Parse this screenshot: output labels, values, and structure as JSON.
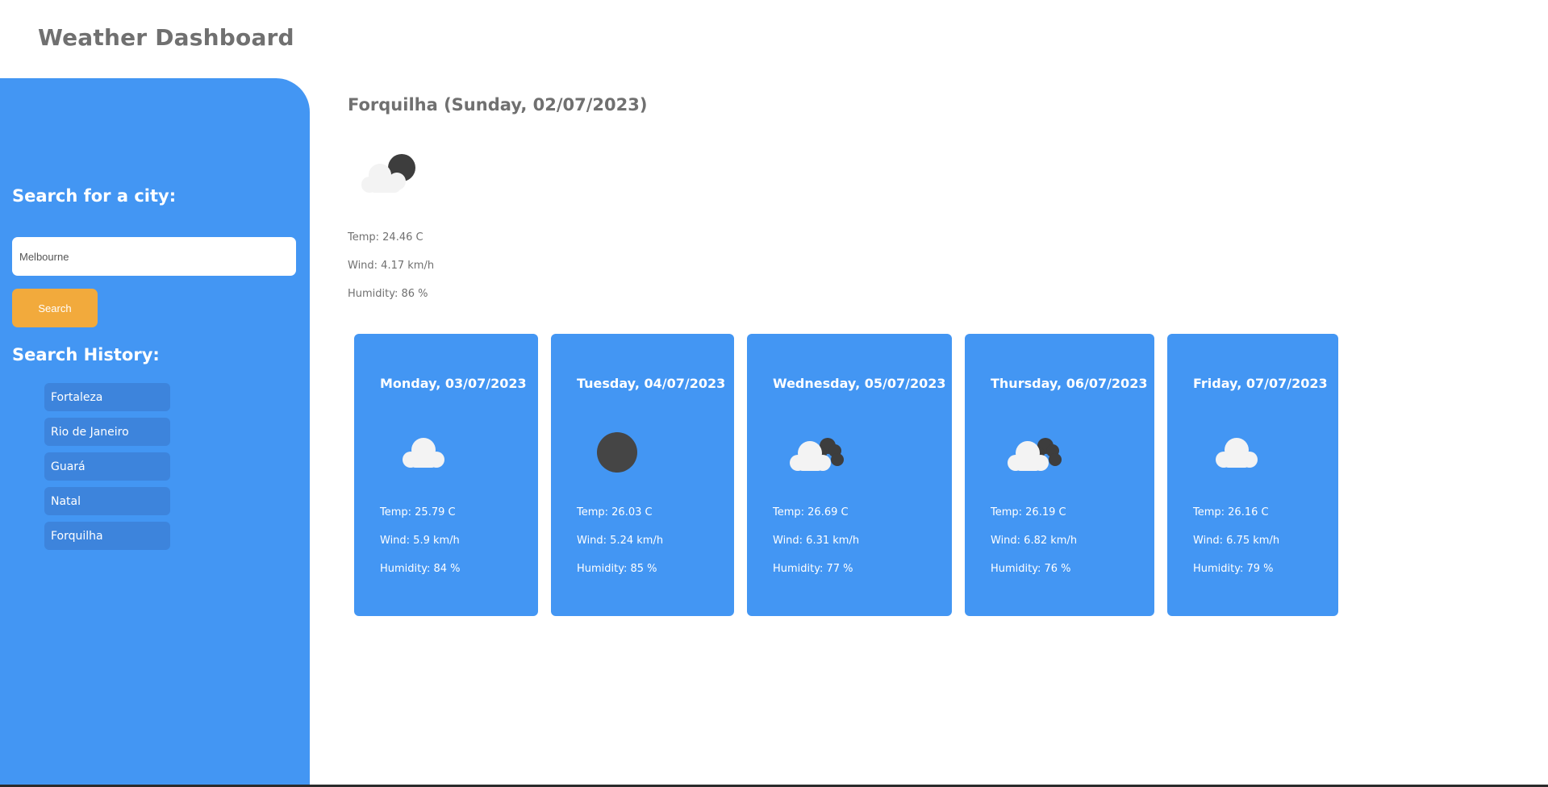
{
  "header": {
    "title": "Weather Dashboard"
  },
  "sidebar": {
    "search_heading": "Search for a city:",
    "search_value": "Melbourne",
    "search_button": "Search",
    "history_heading": "Search History:",
    "history": [
      "Fortaleza",
      "Rio de Janeiro",
      "Guará",
      "Natal",
      "Forquilha"
    ]
  },
  "colors": {
    "accent": "#4396f3",
    "button": "#f2aa3c",
    "history_item": "#3d84dc",
    "text_muted": "#707070"
  },
  "current": {
    "title": "Forquilha (Sunday, 02/07/2023)",
    "icon": "cloud-moon-icon",
    "temp": "Temp: 24.46 C",
    "wind": "Wind: 4.17 km/h",
    "humidity": "Humidity: 86 %"
  },
  "forecast": [
    {
      "date": "Monday, 03/07/2023",
      "icon": "cloud-icon",
      "temp": "Temp: 25.79 C",
      "wind": "Wind: 5.9 km/h",
      "humidity": "Humidity: 84 %"
    },
    {
      "date": "Tuesday, 04/07/2023",
      "icon": "moon-icon",
      "temp": "Temp: 26.03 C",
      "wind": "Wind: 5.24 km/h",
      "humidity": "Humidity: 85 %"
    },
    {
      "date": "Wednesday, 05/07/2023",
      "icon": "broken-clouds-icon",
      "temp": "Temp: 26.69 C",
      "wind": "Wind: 6.31 km/h",
      "humidity": "Humidity: 77 %"
    },
    {
      "date": "Thursday, 06/07/2023",
      "icon": "broken-clouds-icon",
      "temp": "Temp: 26.19 C",
      "wind": "Wind: 6.82 km/h",
      "humidity": "Humidity: 76 %"
    },
    {
      "date": "Friday, 07/07/2023",
      "icon": "cloud-icon",
      "temp": "Temp: 26.16 C",
      "wind": "Wind: 6.75 km/h",
      "humidity": "Humidity: 79 %"
    }
  ]
}
